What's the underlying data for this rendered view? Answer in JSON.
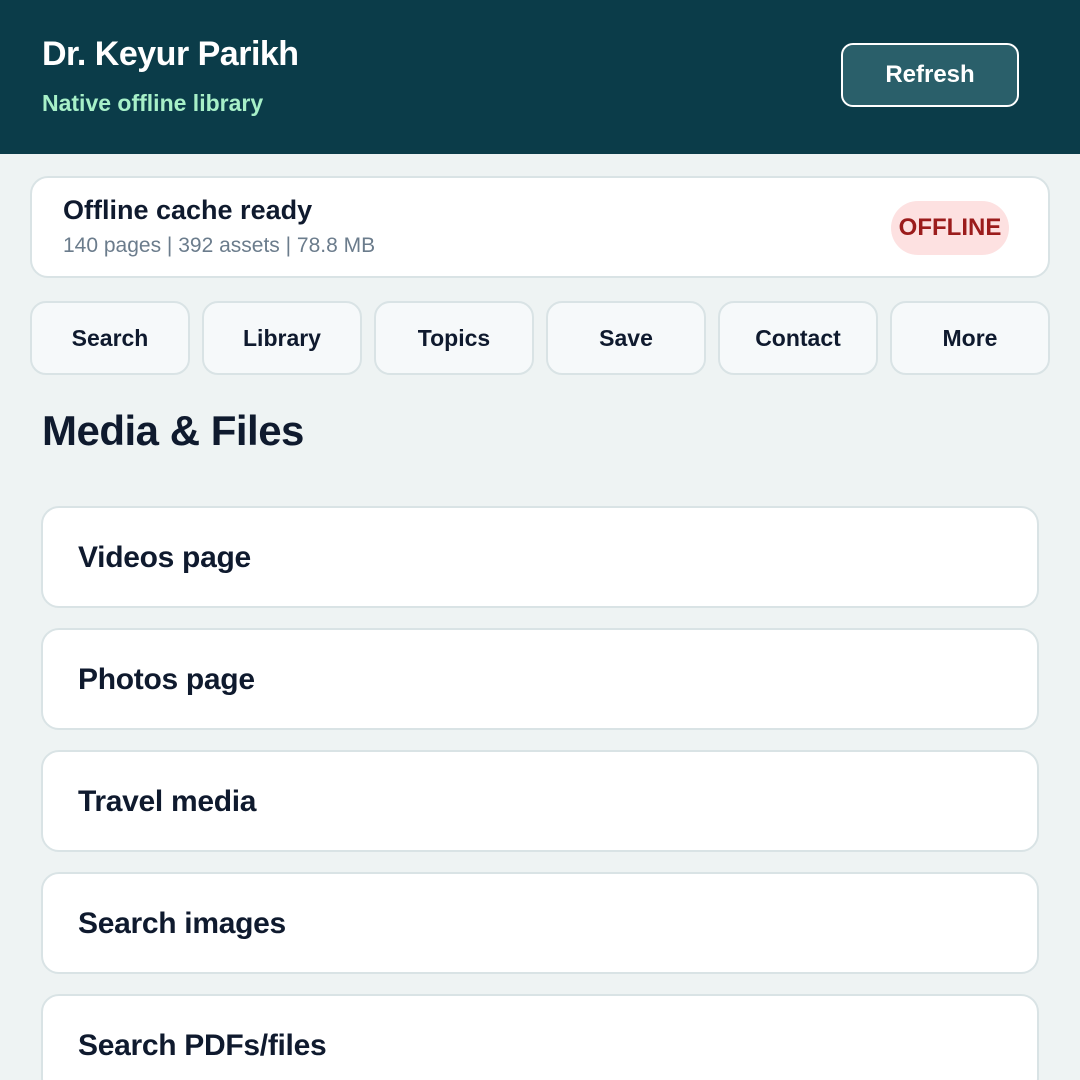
{
  "header": {
    "title": "Dr. Keyur Parikh",
    "subtitle": "Native offline library",
    "refresh_label": "Refresh"
  },
  "status": {
    "title": "Offline cache ready",
    "meta": "140 pages | 392 assets | 78.8 MB",
    "badge": "OFFLINE"
  },
  "nav": {
    "items": [
      {
        "label": "Search"
      },
      {
        "label": "Library"
      },
      {
        "label": "Topics"
      },
      {
        "label": "Save"
      },
      {
        "label": "Contact"
      },
      {
        "label": "More"
      }
    ]
  },
  "main": {
    "section_title": "Media & Files",
    "items": [
      {
        "label": "Videos page"
      },
      {
        "label": "Photos page"
      },
      {
        "label": "Travel media"
      },
      {
        "label": "Search images"
      },
      {
        "label": "Search PDFs/files"
      }
    ]
  },
  "colors": {
    "header_bg": "#0b3c49",
    "subtitle_accent": "#a7f0c8",
    "offline_badge_bg": "#fde1e1",
    "offline_badge_text": "#9b1c1c",
    "page_bg": "#eef3f3"
  }
}
